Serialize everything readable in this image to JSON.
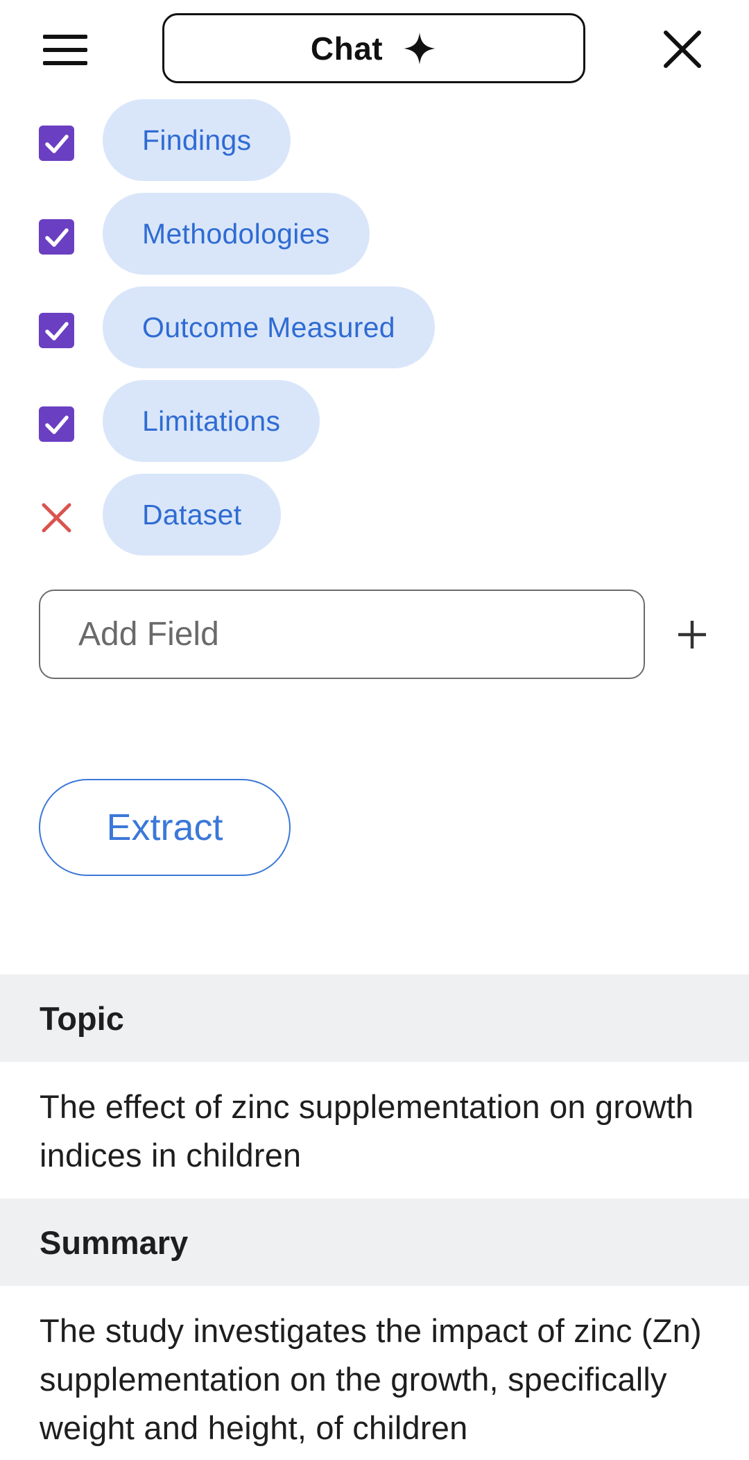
{
  "header": {
    "chat_label": "Chat",
    "menu_icon": "hamburger-menu-icon",
    "sparkle_icon": "sparkle-icon",
    "close_icon": "close-icon"
  },
  "fields": [
    {
      "label": "Findings",
      "checked": true
    },
    {
      "label": "Methodologies",
      "checked": true
    },
    {
      "label": "Outcome Measured",
      "checked": true
    },
    {
      "label": "Limitations",
      "checked": true
    },
    {
      "label": "Dataset",
      "checked": false
    }
  ],
  "add_field": {
    "placeholder": "Add Field",
    "value": ""
  },
  "extract": {
    "label": "Extract"
  },
  "results": {
    "topic": {
      "heading": "Topic",
      "text": "The effect of zinc supplementation on growth indices in children"
    },
    "summary": {
      "heading": "Summary",
      "text": "The study investigates the impact of zinc (Zn) supplementation on the growth, specifically weight and height, of children"
    }
  },
  "colors": {
    "checkbox": "#6a3fc2",
    "chip_bg": "#d9e6fa",
    "chip_text": "#2f6bd2",
    "remove_x": "#d9534f",
    "accent": "#3b78d8",
    "section_header_bg": "#eff0f2"
  }
}
